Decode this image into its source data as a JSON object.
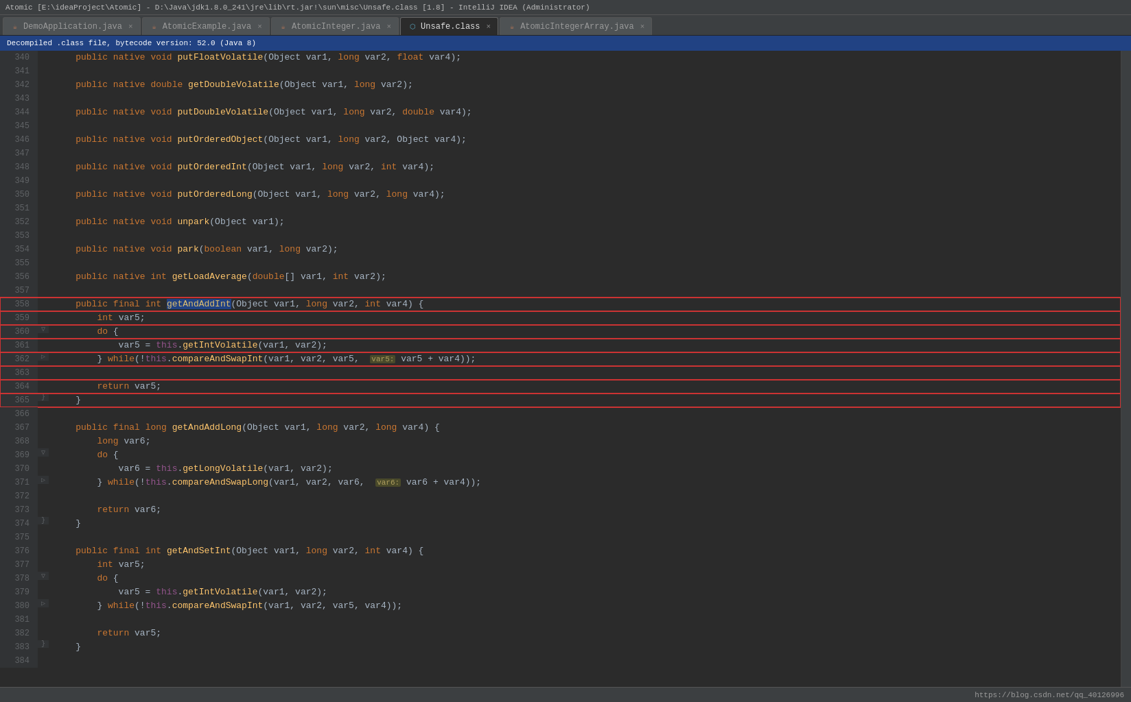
{
  "titleBar": {
    "text": "Atomic [E:\\ideaProject\\Atomic] - D:\\Java\\jdk1.8.0_241\\jre\\lib\\rt.jar!\\sun\\misc\\Unsafe.class [1.8] - IntelliJ IDEA (Administrator)"
  },
  "tabs": [
    {
      "id": "demo",
      "label": "DemoApplication.java",
      "type": "java",
      "active": false,
      "closable": true
    },
    {
      "id": "atomic",
      "label": "AtomicExample.java",
      "type": "java",
      "active": false,
      "closable": true
    },
    {
      "id": "atomicint",
      "label": "AtomicInteger.java",
      "type": "java",
      "active": false,
      "closable": true
    },
    {
      "id": "unsafe",
      "label": "Unsafe.class",
      "type": "class",
      "active": true,
      "closable": true
    },
    {
      "id": "atomicintarray",
      "label": "AtomicIntegerArray.java",
      "type": "java",
      "active": false,
      "closable": true
    }
  ],
  "infoBar": {
    "text": "Decompiled .class file, bytecode version: 52.0 (Java 8)"
  },
  "lines": [
    {
      "num": 340,
      "indent": 4,
      "gutter": "",
      "code": "    public native void putFloatVolatile(Object var1, long var2, float var4);"
    },
    {
      "num": 341,
      "indent": 0,
      "gutter": "",
      "code": ""
    },
    {
      "num": 342,
      "indent": 4,
      "gutter": "",
      "code": "    public native double getDoubleVolatile(Object var1, long var2);"
    },
    {
      "num": 343,
      "indent": 0,
      "gutter": "",
      "code": ""
    },
    {
      "num": 344,
      "indent": 4,
      "gutter": "",
      "code": "    public native void putDoubleVolatile(Object var1, long var2, double var4);"
    },
    {
      "num": 345,
      "indent": 0,
      "gutter": "",
      "code": ""
    },
    {
      "num": 346,
      "indent": 4,
      "gutter": "",
      "code": "    public native void putOrderedObject(Object var1, long var2, Object var4);"
    },
    {
      "num": 347,
      "indent": 0,
      "gutter": "",
      "code": ""
    },
    {
      "num": 348,
      "indent": 4,
      "gutter": "",
      "code": "    public native void putOrderedInt(Object var1, long var2, int var4);"
    },
    {
      "num": 349,
      "indent": 0,
      "gutter": "",
      "code": ""
    },
    {
      "num": 350,
      "indent": 4,
      "gutter": "",
      "code": "    public native void putOrderedLong(Object var1, long var2, long var4);"
    },
    {
      "num": 351,
      "indent": 0,
      "gutter": "",
      "code": ""
    },
    {
      "num": 352,
      "indent": 4,
      "gutter": "",
      "code": "    public native void unpark(Object var1);"
    },
    {
      "num": 353,
      "indent": 0,
      "gutter": "",
      "code": ""
    },
    {
      "num": 354,
      "indent": 4,
      "gutter": "",
      "code": "    public native void park(boolean var1, long var2);"
    },
    {
      "num": 355,
      "indent": 0,
      "gutter": "",
      "code": ""
    },
    {
      "num": 356,
      "indent": 4,
      "gutter": "",
      "code": "    public native int getLoadAverage(double[] var1, int var2);"
    },
    {
      "num": 357,
      "indent": 0,
      "gutter": "",
      "code": ""
    },
    {
      "num": 358,
      "indent": 4,
      "gutter": "",
      "code": "    public final int getAndAddInt(Object var1, long var2, int var4) {",
      "highlight": true,
      "gutter_mark": ""
    },
    {
      "num": 359,
      "indent": 8,
      "gutter": "",
      "code": "        int var5;",
      "highlight": true
    },
    {
      "num": 360,
      "indent": 8,
      "gutter": "▽",
      "code": "        do {",
      "highlight": true
    },
    {
      "num": 361,
      "indent": 12,
      "gutter": "",
      "code": "            var5 = this.getIntVolatile(var1, var2);",
      "highlight": true
    },
    {
      "num": 362,
      "indent": 8,
      "gutter": "▷",
      "code": "        } while(!this.compareAndSwapInt(var1, var2, var5,  var5 + var4));",
      "highlight": true,
      "hint": "var5:"
    },
    {
      "num": 363,
      "indent": 0,
      "gutter": "",
      "code": "",
      "highlight": true
    },
    {
      "num": 364,
      "indent": 8,
      "gutter": "",
      "code": "        return var5;",
      "highlight": true
    },
    {
      "num": 365,
      "indent": 4,
      "gutter": "}",
      "code": "    }",
      "highlight": true
    },
    {
      "num": 366,
      "indent": 0,
      "gutter": "",
      "code": ""
    },
    {
      "num": 367,
      "indent": 4,
      "gutter": "",
      "code": "    public final long getAndAddLong(Object var1, long var2, long var4) {"
    },
    {
      "num": 368,
      "indent": 8,
      "gutter": "",
      "code": "        long var6;"
    },
    {
      "num": 369,
      "indent": 8,
      "gutter": "▽",
      "code": "        do {"
    },
    {
      "num": 370,
      "indent": 12,
      "gutter": "",
      "code": "            var6 = this.getLongVolatile(var1, var2);"
    },
    {
      "num": 371,
      "indent": 8,
      "gutter": "▷",
      "code": "        } while(!this.compareAndSwapLong(var1, var2, var6,  var6 + var4));",
      "hint": "var6:"
    },
    {
      "num": 372,
      "indent": 0,
      "gutter": "",
      "code": ""
    },
    {
      "num": 373,
      "indent": 8,
      "gutter": "",
      "code": "        return var6;"
    },
    {
      "num": 374,
      "indent": 4,
      "gutter": "}",
      "code": "    }"
    },
    {
      "num": 375,
      "indent": 0,
      "gutter": "",
      "code": ""
    },
    {
      "num": 376,
      "indent": 4,
      "gutter": "",
      "code": "    public final int getAndSetInt(Object var1, long var2, int var4) {"
    },
    {
      "num": 377,
      "indent": 8,
      "gutter": "",
      "code": "        int var5;"
    },
    {
      "num": 378,
      "indent": 8,
      "gutter": "▽",
      "code": "        do {"
    },
    {
      "num": 379,
      "indent": 12,
      "gutter": "",
      "code": "            var5 = this.getIntVolatile(var1, var2);"
    },
    {
      "num": 380,
      "indent": 8,
      "gutter": "▷",
      "code": "        } while(!this.compareAndSwapInt(var1, var2, var5, var4));"
    },
    {
      "num": 381,
      "indent": 0,
      "gutter": "",
      "code": ""
    },
    {
      "num": 382,
      "indent": 8,
      "gutter": "",
      "code": "        return var5;"
    },
    {
      "num": 383,
      "indent": 4,
      "gutter": "}",
      "code": "    }"
    },
    {
      "num": 384,
      "indent": 0,
      "gutter": "",
      "code": ""
    }
  ],
  "bottomBar": {
    "url": "https://blog.csdn.net/qq_40126996"
  }
}
